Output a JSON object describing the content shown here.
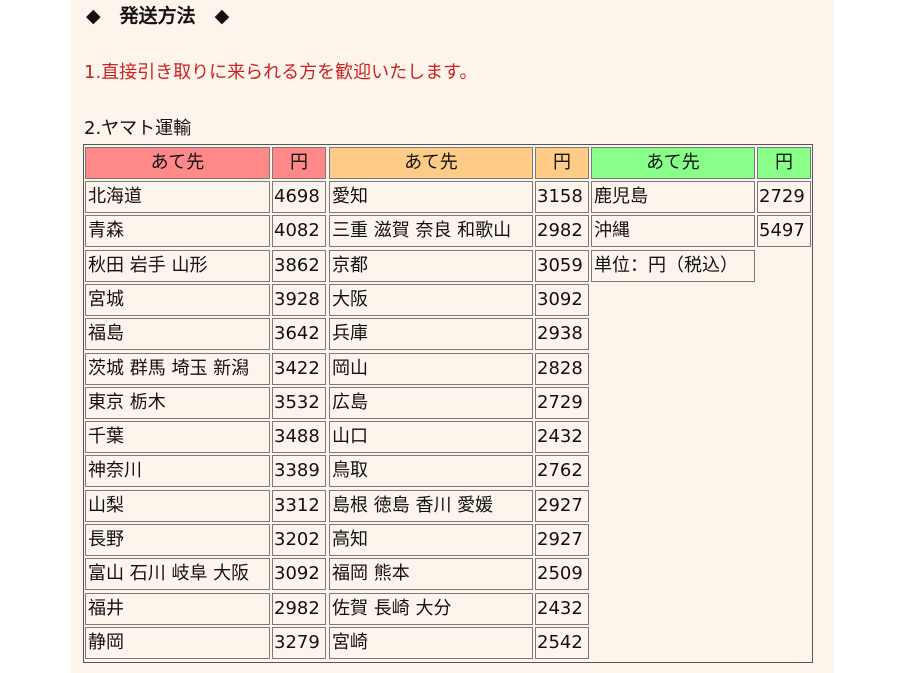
{
  "heading": "◆　発送方法　◆",
  "notice": "1.直接引き取りに来られる方を歓迎いたします。",
  "section_title": "2.ヤマト運輸",
  "colors": {
    "header_red": "#ff8888",
    "header_orange": "#ffcc88",
    "header_green": "#88ff88",
    "notice_red": "#cc2222",
    "panel_bg": "#fdf5ec"
  },
  "table": {
    "headers": [
      {
        "dest": "あて先",
        "price": "円"
      },
      {
        "dest": "あて先",
        "price": "円"
      },
      {
        "dest": "あて先",
        "price": "円"
      }
    ],
    "groups": [
      [
        {
          "dest": "北海道",
          "price": "4698"
        },
        {
          "dest": "青森",
          "price": "4082"
        },
        {
          "dest": "秋田 岩手 山形",
          "price": "3862"
        },
        {
          "dest": "宮城",
          "price": "3928"
        },
        {
          "dest": "福島",
          "price": "3642"
        },
        {
          "dest": "茨城 群馬 埼玉 新潟",
          "price": "3422"
        },
        {
          "dest": "東京 栃木",
          "price": "3532"
        },
        {
          "dest": "千葉",
          "price": "3488"
        },
        {
          "dest": "神奈川",
          "price": "3389"
        },
        {
          "dest": "山梨",
          "price": "3312"
        },
        {
          "dest": "長野",
          "price": "3202"
        },
        {
          "dest": "富山 石川 岐阜 大阪",
          "price": "3092"
        },
        {
          "dest": "福井",
          "price": "2982"
        },
        {
          "dest": "静岡",
          "price": "3279"
        }
      ],
      [
        {
          "dest": "愛知",
          "price": "3158"
        },
        {
          "dest": "三重 滋賀 奈良 和歌山",
          "price": "2982"
        },
        {
          "dest": "京都",
          "price": "3059"
        },
        {
          "dest": "大阪",
          "price": "3092"
        },
        {
          "dest": "兵庫",
          "price": "2938"
        },
        {
          "dest": "岡山",
          "price": "2828"
        },
        {
          "dest": "広島",
          "price": "2729"
        },
        {
          "dest": "山口",
          "price": "2432"
        },
        {
          "dest": "鳥取",
          "price": "2762"
        },
        {
          "dest": "島根 徳島 香川 愛媛",
          "price": "2927"
        },
        {
          "dest": "高知",
          "price": "2927"
        },
        {
          "dest": "福岡 熊本",
          "price": "2509"
        },
        {
          "dest": "佐賀 長崎 大分",
          "price": "2432"
        },
        {
          "dest": "宮崎",
          "price": "2542"
        }
      ],
      [
        {
          "dest": "鹿児島",
          "price": "2729"
        },
        {
          "dest": "沖縄",
          "price": "5497"
        }
      ]
    ],
    "unit_note": "単位：円（税込）"
  }
}
